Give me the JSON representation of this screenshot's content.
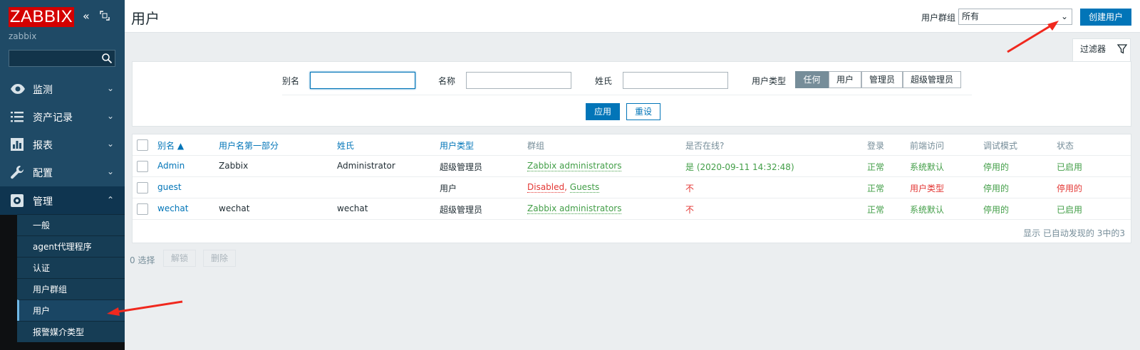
{
  "sidebar": {
    "logo": "ZABBIX",
    "server_name": "zabbix",
    "search_placeholder": "",
    "menu": [
      {
        "label": "监测",
        "icon": "eye-icon"
      },
      {
        "label": "资产记录",
        "icon": "list-icon"
      },
      {
        "label": "报表",
        "icon": "bar-chart-icon"
      },
      {
        "label": "配置",
        "icon": "wrench-icon"
      },
      {
        "label": "管理",
        "icon": "gear-icon"
      }
    ],
    "submenu": [
      "一般",
      "agent代理程序",
      "认证",
      "用户群组",
      "用户",
      "报警媒介类型"
    ]
  },
  "header": {
    "title": "用户",
    "group_label": "用户群组",
    "group_value": "所有",
    "create_button": "创建用户"
  },
  "filter": {
    "tab_label": "过滤器",
    "alias_label": "别名",
    "name_label": "名称",
    "surname_label": "姓氏",
    "type_label": "用户类型",
    "type_options": [
      "任何",
      "用户",
      "管理员",
      "超级管理员"
    ],
    "type_selected": "任何",
    "apply": "应用",
    "reset": "重设"
  },
  "table": {
    "columns": [
      "别名 ▲",
      "用户名第一部分",
      "姓氏",
      "用户类型",
      "群组",
      "是否在线?",
      "登录",
      "前端访问",
      "调试模式",
      "状态"
    ],
    "rows": [
      {
        "alias": "Admin",
        "name": "Zabbix",
        "surname": "Administrator",
        "type": "超级管理员",
        "group_a": "Zabbix administrators",
        "group_b": "",
        "online": "是 (2020-09-11 14:32:48)",
        "login": "正常",
        "frontend": "系统默认",
        "debug": "停用的",
        "status": "已启用"
      },
      {
        "alias": "guest",
        "name": "",
        "surname": "",
        "type": "用户",
        "group_a": "Disabled",
        "group_b": "Guests",
        "online": "不",
        "login": "正常",
        "frontend": "用户类型",
        "debug": "停用的",
        "status": "停用的"
      },
      {
        "alias": "wechat",
        "name": "wechat",
        "surname": "wechat",
        "type": "超级管理员",
        "group_a": "Zabbix administrators",
        "group_b": "",
        "online": "不",
        "login": "正常",
        "frontend": "系统默认",
        "debug": "停用的",
        "status": "已启用"
      }
    ],
    "footer": "显示 已自动发现的 3中的3"
  },
  "actions": {
    "selected": "0 选择",
    "unblock": "解锁",
    "delete": "删除"
  }
}
